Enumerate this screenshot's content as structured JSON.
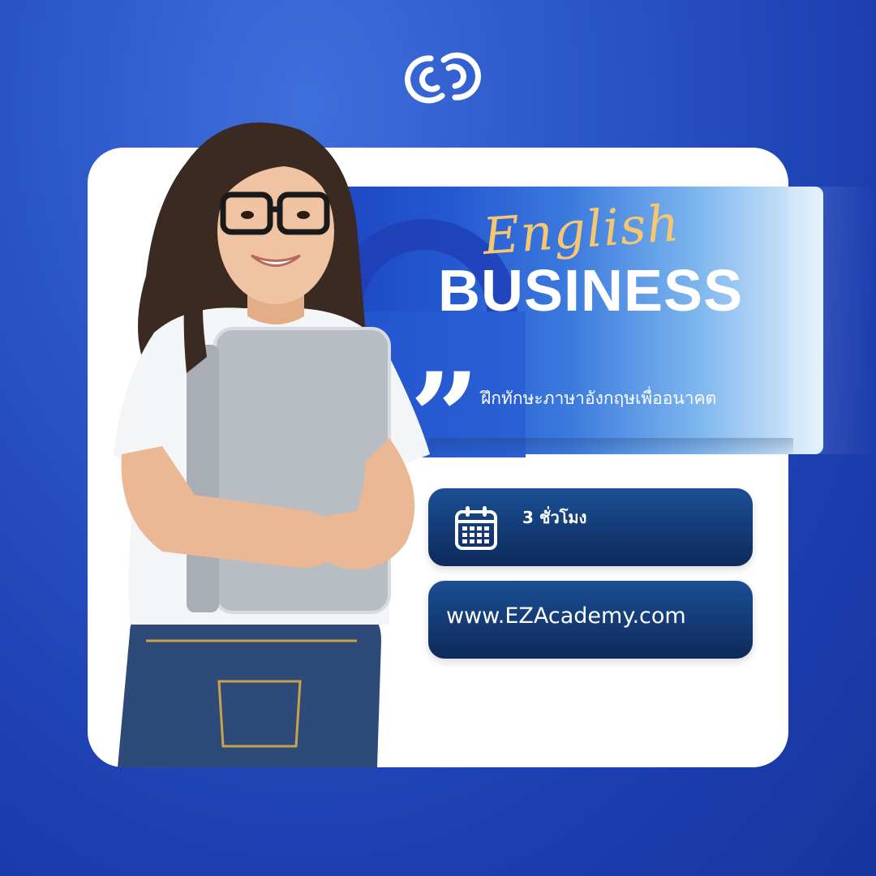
{
  "brand": {
    "logo_icon": "interlocking-rings-logo"
  },
  "hero": {
    "title_script": "English",
    "title_main": "BUSINESS",
    "tagline": "ฝึกทักษะภาษาอังกฤษเพื่ออนาคต",
    "quote_icon": "quote-icon"
  },
  "info": {
    "duration": "3 ชั่วโมง",
    "duration_icon": "calendar-icon",
    "website": "www.EZAcademy.com"
  },
  "colors": {
    "background": "#2b56c6",
    "card": "#ffffff",
    "accent_script": "#f6c770",
    "pill_top": "#1b4f95",
    "pill_bottom": "#0d2a5a"
  }
}
